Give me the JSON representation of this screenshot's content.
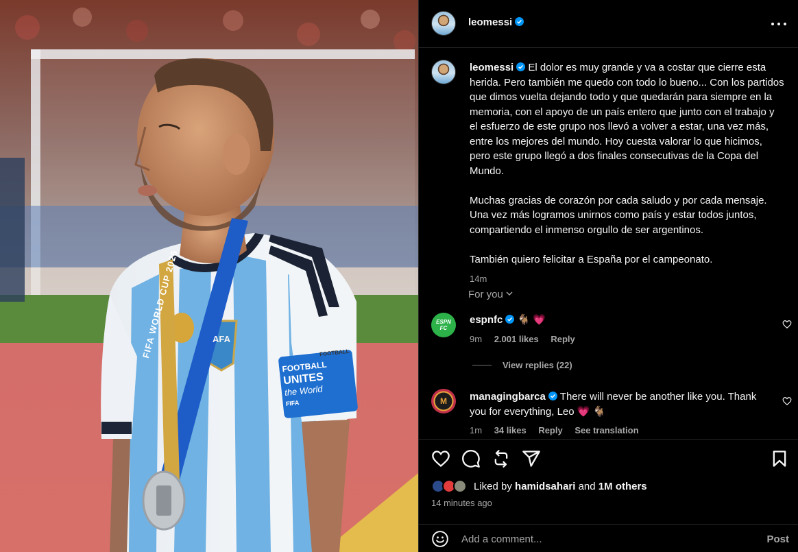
{
  "post": {
    "author": "leomessi",
    "caption_paragraphs": [
      "El dolor es muy grande y va a costar que cierre esta herida. Pero también me quedo con todo lo bueno... Con los partidos que dimos vuelta dejando todo y que quedarán para siempre en la memoria, con el apoyo de un país entero que junto con el trabajo y el esfuerzo de este grupo nos llevó a volver a estar, una vez más, entre los mejores del mundo. Hoy cuesta valorar lo que hicimos, pero este grupo llegó a dos finales consecutivas de la Copa del Mundo.",
      "Muchas gracias de corazón por cada saludo y por cada mensaje. Una vez más logramos unirnos como país y estar todos juntos, compartiendo el inmenso orgullo de ser argentinos.",
      "También quiero felicitar a España por el campeonato."
    ],
    "caption_time": "14m"
  },
  "image": {
    "sash_lines": [
      "FIFA WORLD CUP 2026"
    ],
    "armband_lines": [
      "FOOTBALL",
      "UNITES",
      "the World",
      "FIFA"
    ],
    "crest_text": "AFA",
    "sleeve_text": "FOOTBALL"
  },
  "for_you": "For you",
  "comments": [
    {
      "user": "espnfc",
      "avatar_text": "ESPN FC",
      "text": "🐐 💗",
      "time": "9m",
      "likes": "2.001 likes",
      "reply": "Reply",
      "view_replies": "View replies (22)"
    },
    {
      "user": "managingbarca",
      "avatar_text": "M",
      "text": "There will never be another like you. Thank you for everything, Leo 💗 🐐",
      "time": "1m",
      "likes": "34 likes",
      "reply": "Reply",
      "translate": "See translation"
    }
  ],
  "likes": {
    "prefix": "Liked by",
    "user": "hamidsahari",
    "conj": "and",
    "others": "1M others"
  },
  "time_ago": "14 minutes ago",
  "add_comment": {
    "placeholder": "Add a comment...",
    "post_label": "Post"
  },
  "colors": {
    "verified": "#0095f6",
    "heart": "#ff3f8e",
    "espn_green": "#2db24a",
    "text_secondary": "#a8a8a8"
  }
}
